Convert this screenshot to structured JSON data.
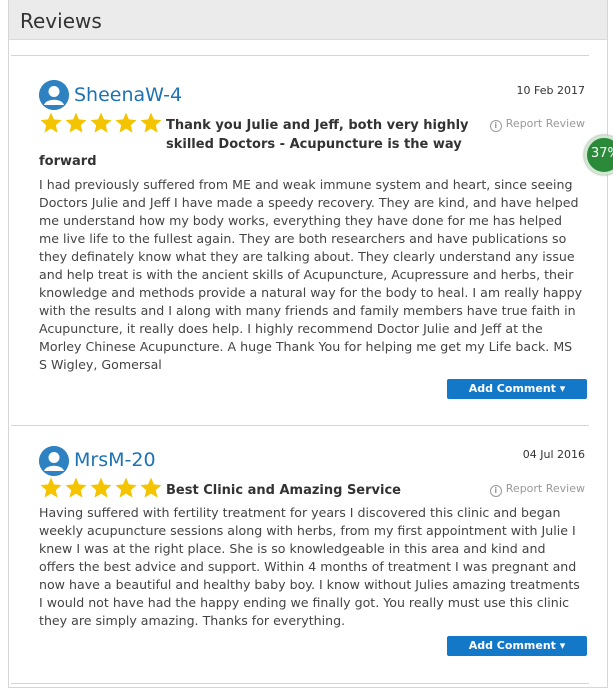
{
  "header": {
    "title": "Reviews"
  },
  "reviews": [
    {
      "username": "SheenaW-4",
      "date": "10 Feb 2017",
      "rating": 5,
      "title_line1": "Thank you Julie and Jeff, both very highly",
      "title_line2": "skilled Doctors - Acupuncture is the way",
      "title_line3": "forward",
      "report_label": "Report Review",
      "body": "I had previously suffered from ME and weak immune system and heart, since seeing Doctors Julie and Jeff I have made a speedy recovery. They are kind, and have helped me understand how my body works, everything they have done for me has helped me live life to the fullest again. They are both researchers and have publications so they definately know what they are talking about. They clearly understand any issue and help treat is with the ancient skills of Acupuncture, Acupressure and herbs, their knowledge and methods provide a natural way for the body to heal. I am really happy with the results and I along with many friends and family members have true faith in Acupuncture, it really does help. I highly recommend Doctor Julie and Jeff at the Morley Chinese Acupuncture. A huge Thank You for helping me get my Life back. MS S Wigley, Gomersal",
      "button_label": "Add Comment ▾"
    },
    {
      "username": "MrsM-20",
      "date": "04 Jul 2016",
      "rating": 5,
      "title_line1": "Best Clinic and Amazing Service",
      "report_label": "Report Review",
      "body": "Having suffered with fertility treatment for years I discovered this clinic and began weekly acupuncture sessions along with herbs, from my first appointment with Julie I knew I was at the right place. She is so knowledgeable in this area and kind and offers the best advice and support. Within 4 months of treatment I was pregnant and now have a beautiful and healthy baby boy. I know without Julies amazing treatments I would not have had the happy ending we finally got. You really must use this clinic they are simply amazing. Thanks for everything.",
      "button_label": "Add Comment ▾"
    }
  ],
  "badge": {
    "text": "37%"
  },
  "colors": {
    "username": "#1d72b5",
    "star": "#f5c400",
    "button": "#1478c8",
    "avatar": "#2e82c2"
  }
}
